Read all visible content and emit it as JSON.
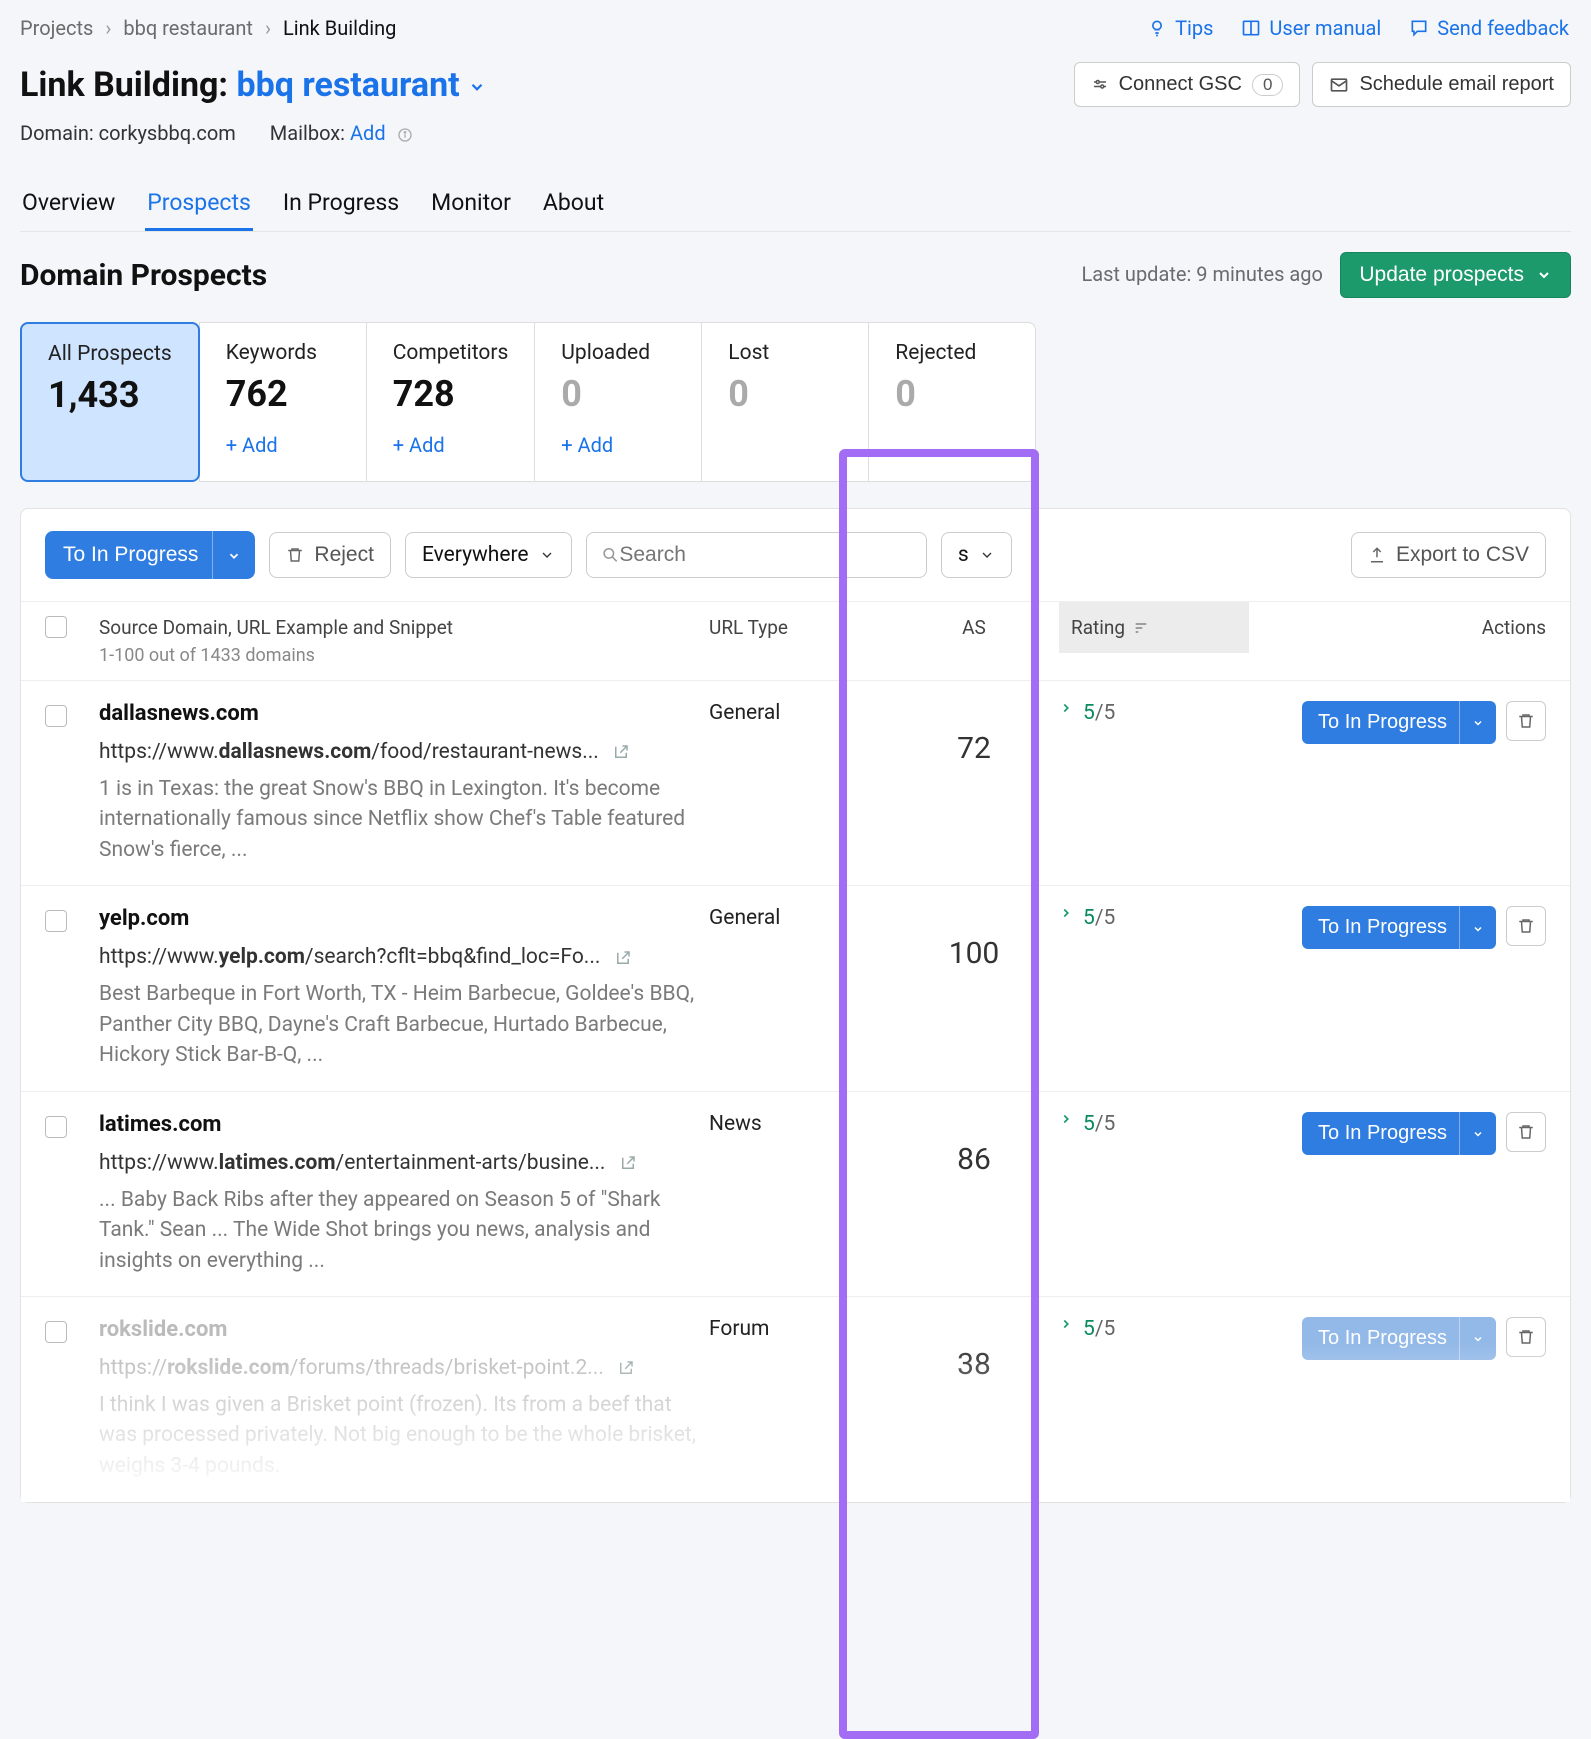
{
  "breadcrumb": {
    "item1": "Projects",
    "item2": "bbq restaurant",
    "item3": "Link Building"
  },
  "toplinks": {
    "tips": "Tips",
    "manual": "User manual",
    "feedback": "Send feedback"
  },
  "title": {
    "prefix": "Link Building: ",
    "project": "bbq restaurant"
  },
  "title_buttons": {
    "gsc": "Connect GSC",
    "gsc_badge": "0",
    "schedule": "Schedule email report"
  },
  "meta": {
    "domain_label": "Domain:",
    "domain_value": "corkysbbq.com",
    "mailbox_label": "Mailbox:",
    "mailbox_add": "Add"
  },
  "tabs": {
    "overview": "Overview",
    "prospects": "Prospects",
    "inprogress": "In Progress",
    "monitor": "Monitor",
    "about": "About"
  },
  "section": {
    "title": "Domain Prospects",
    "last_update": "Last update: 9 minutes ago",
    "update_btn": "Update prospects"
  },
  "cards": {
    "all": {
      "label": "All Prospects",
      "value": "1,433"
    },
    "keywords": {
      "label": "Keywords",
      "value": "762",
      "add": "+ Add"
    },
    "competitors": {
      "label": "Competitors",
      "value": "728",
      "add": "+ Add"
    },
    "uploaded": {
      "label": "Uploaded",
      "value": "0",
      "add": "+ Add"
    },
    "lost": {
      "label": "Lost",
      "value": "0"
    },
    "rejected": {
      "label": "Rejected",
      "value": "0"
    }
  },
  "toolbar": {
    "to_in_progress": "To In Progress",
    "reject": "Reject",
    "everywhere": "Everywhere",
    "search_placeholder": "Search",
    "filter_s": "s",
    "export": "Export to CSV"
  },
  "thead": {
    "source": "Source Domain, URL Example and Snippet",
    "range": "1-100 out of 1433 domains",
    "url_type": "URL Type",
    "as": "AS",
    "rating": "Rating",
    "actions": "Actions"
  },
  "as_values": [
    "72",
    "100",
    "86",
    "38"
  ],
  "rows": [
    {
      "domain": "dallasnews.com",
      "url_pre": "https://www.",
      "url_bold": "dallasnews.com",
      "url_post": "/food/restaurant-news...",
      "snippet": "1 is in Texas: the great Snow's BBQ in Lexington. It's become internationally famous since Netflix show Chef's Table featured Snow's fierce, ...",
      "type": "General",
      "rating_num": "5",
      "rating_denom": "/5",
      "btn": "To In Progress"
    },
    {
      "domain": "yelp.com",
      "url_pre": "https://www.",
      "url_bold": "yelp.com",
      "url_post": "/search?cflt=bbq&find_loc=Fo...",
      "snippet": "Best Barbeque in Fort Worth, TX - Heim Barbecue, Goldee's BBQ, Panther City BBQ, Dayne's Craft Barbecue, Hurtado Barbecue, Hickory Stick Bar-B-Q, ...",
      "type": "General",
      "rating_num": "5",
      "rating_denom": "/5",
      "btn": "To In Progress"
    },
    {
      "domain": "latimes.com",
      "url_pre": "https://www.",
      "url_bold": "latimes.com",
      "url_post": "/entertainment-arts/busine...",
      "snippet": "... Baby Back Ribs after they appeared on Season 5 of \"Shark Tank.\" Sean ... The Wide Shot brings you news, analysis and insights on everything ...",
      "type": "News",
      "rating_num": "5",
      "rating_denom": "/5",
      "btn": "To In Progress"
    },
    {
      "domain": "rokslide.com",
      "url_pre": "https://",
      "url_bold": "rokslide.com",
      "url_post": "/forums/threads/brisket-point.2...",
      "snippet": "I think I was given a Brisket point (frozen). Its from a beef that was processed privately. Not big enough to be the whole brisket, weighs 3-4 pounds.",
      "type": "Forum",
      "rating_num": "5",
      "rating_denom": "/5",
      "btn": "To In Progress"
    }
  ]
}
